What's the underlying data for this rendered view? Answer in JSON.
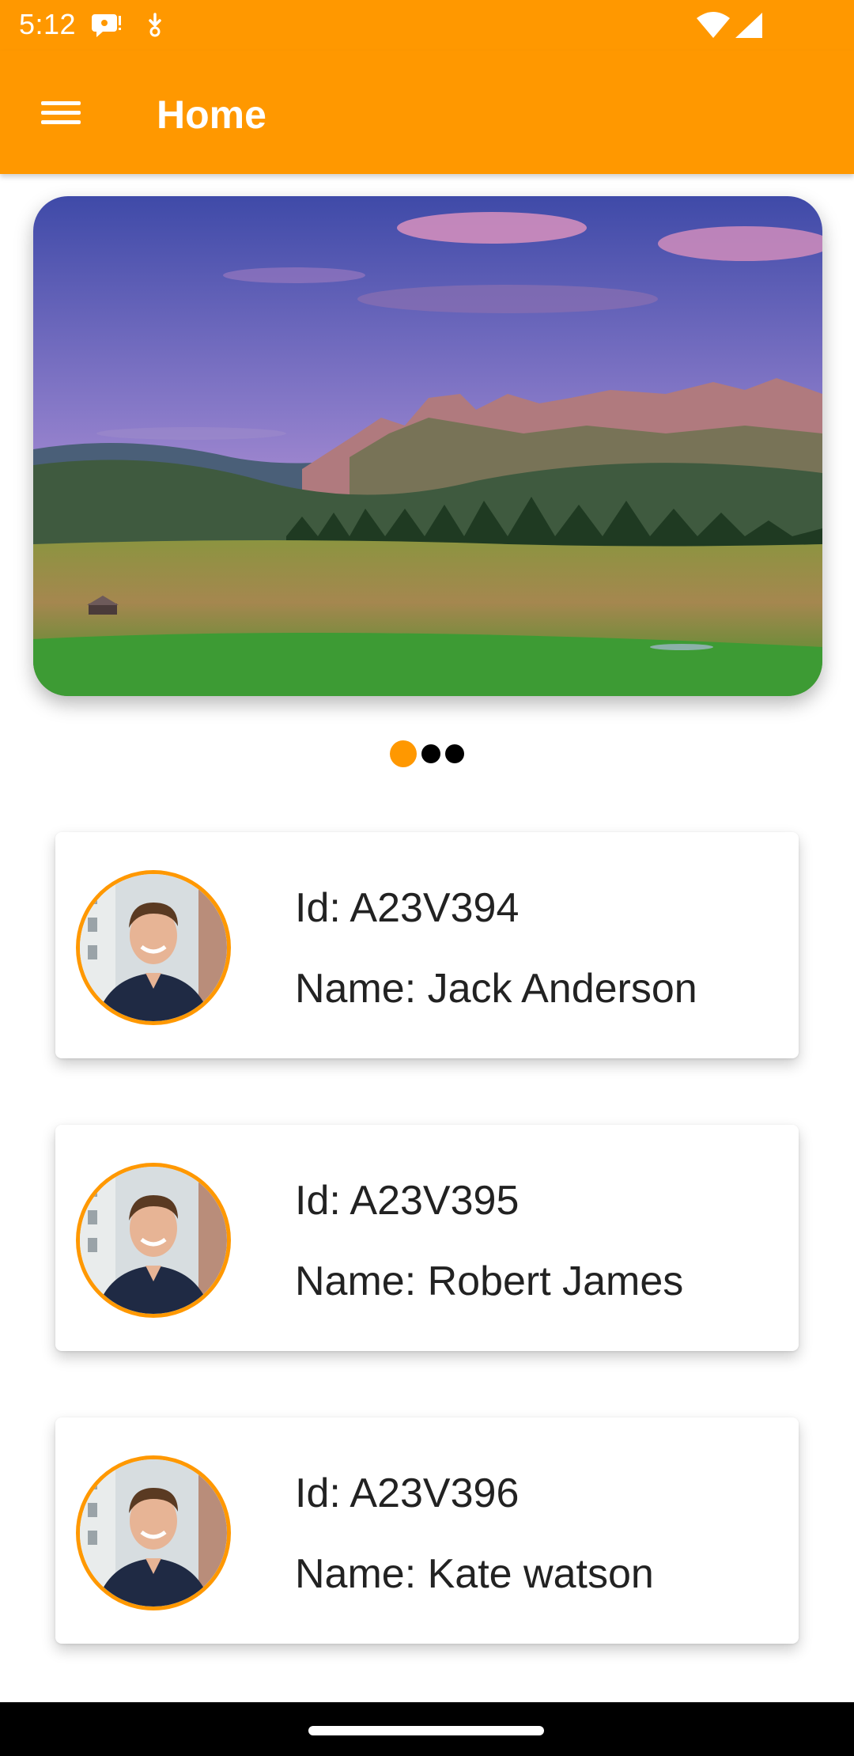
{
  "status_bar": {
    "time": "5:12",
    "icons": [
      "chat-notification-icon",
      "download-notification-icon",
      "wifi-icon",
      "cellular-signal-icon"
    ]
  },
  "app_bar": {
    "title": "Home",
    "menu_icon": "hamburger-menu-icon"
  },
  "carousel": {
    "image": "mountain-landscape-photo",
    "page_count": 3,
    "active_index": 0
  },
  "cards": [
    {
      "id_text": "Id: A23V394",
      "name_text": "Name: Jack Anderson",
      "avatar": "profile-photo"
    },
    {
      "id_text": "Id: A23V395",
      "name_text": "Name: Robert James",
      "avatar": "profile-photo"
    },
    {
      "id_text": "Id: A23V396",
      "name_text": "Name: Kate watson",
      "avatar": "profile-photo"
    }
  ],
  "colors": {
    "primary": "#ff9800",
    "dot_inactive": "#000000",
    "text": "#222222",
    "nav_bar": "#000000"
  }
}
